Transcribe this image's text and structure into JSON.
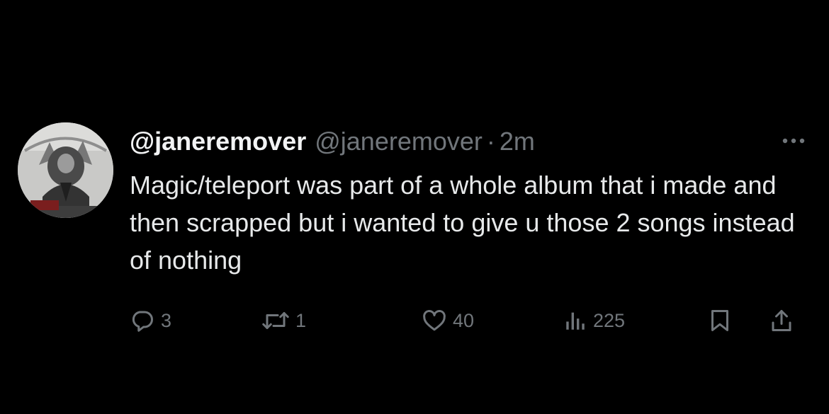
{
  "tweet": {
    "display_name": "@janeremover",
    "handle": "@janeremover",
    "separator": "·",
    "time": "2m",
    "text": "Magic/teleport was part of a whole album that i made and then scrapped but i wanted to give u those 2 songs instead of nothing"
  },
  "actions": {
    "replies": "3",
    "retweets": "1",
    "likes": "40",
    "views": "225"
  },
  "icons": {
    "avatar": "avatar-image",
    "more": "more-dots-icon",
    "reply": "reply-icon",
    "retweet": "retweet-icon",
    "like": "heart-icon",
    "views": "views-bar-chart-icon",
    "bookmark": "bookmark-icon",
    "share": "share-icon"
  },
  "colors": {
    "background": "#000000",
    "primary_text": "#e7e9ea",
    "secondary_text": "#71767b"
  }
}
